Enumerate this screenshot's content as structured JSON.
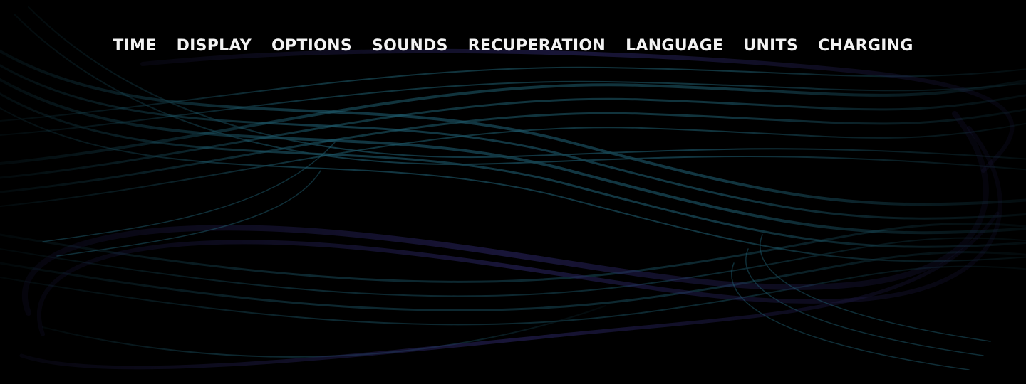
{
  "nav": {
    "items": [
      {
        "label": "TIME"
      },
      {
        "label": "DISPLAY"
      },
      {
        "label": "OPTIONS"
      },
      {
        "label": "SOUNDS"
      },
      {
        "label": "RECUPERATION"
      },
      {
        "label": "LANGUAGE"
      },
      {
        "label": "UNITS"
      },
      {
        "label": "CHARGING"
      }
    ]
  },
  "theme": {
    "background": "#000000",
    "text": "#f2f2f2",
    "wave_teal": "#1f5c6e",
    "wave_purple": "#2a2560"
  }
}
